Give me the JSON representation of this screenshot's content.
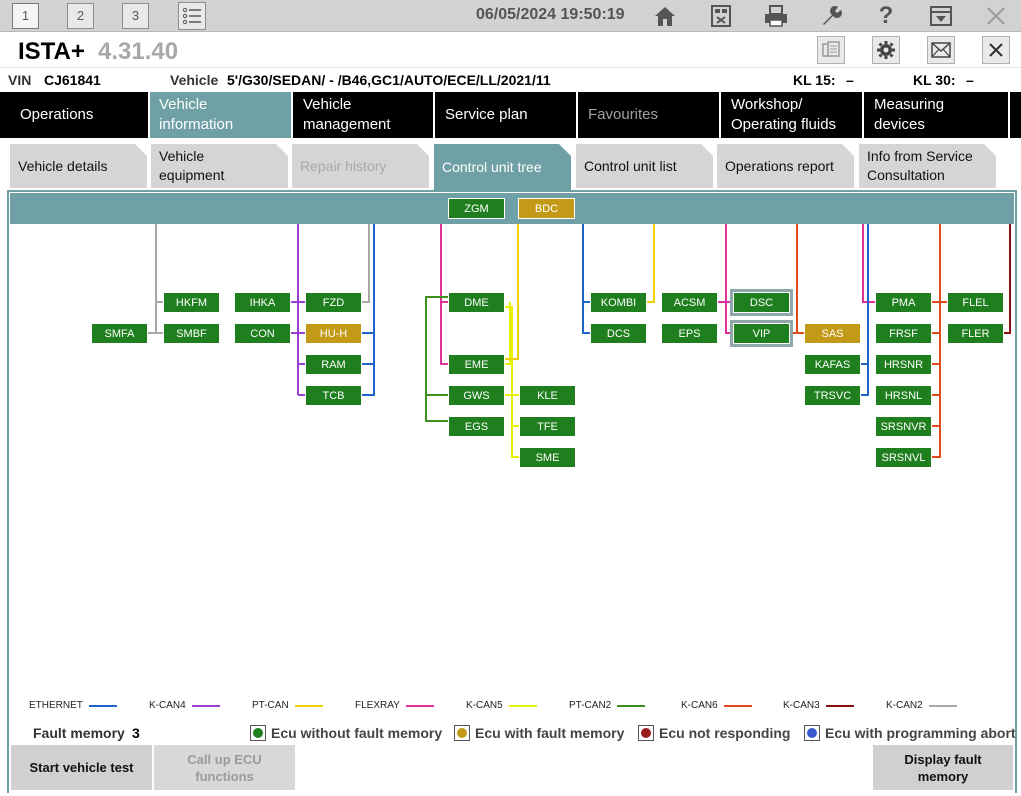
{
  "topbar": {
    "tabs": [
      "1",
      "2",
      "3"
    ],
    "datetime": "06/05/2024 19:50:19",
    "icons": [
      "list-icon",
      "home-icon",
      "connect-icon",
      "printer-icon",
      "wrench-icon",
      "help-icon",
      "menu-down-icon",
      "close-icon"
    ]
  },
  "titlebar": {
    "app": "ISTA+",
    "version": "4.31.40",
    "icons": [
      "document-icon",
      "gear-icon",
      "mail-icon",
      "close-icon"
    ]
  },
  "vin": {
    "vin_label": "VIN",
    "vin_value": "CJ61841",
    "vehicle_label": "Vehicle",
    "vehicle_value": "5'/G30/SEDAN/ - /B46,GC1/AUTO/ECE/LL/2021/11",
    "kl15_label": "KL 15:",
    "kl15_value": "–",
    "kl30_label": "KL 30:",
    "kl30_value": "–"
  },
  "mainnav": {
    "operations": "Operations",
    "vehicle_information": "Vehicle information",
    "vehicle_management_1": "Vehicle",
    "vehicle_management_2": "management",
    "service_plan": "Service plan",
    "favourites": "Favourites",
    "workshop_1": "Workshop/",
    "workshop_2": "Operating fluids",
    "measuring": "Measuring devices"
  },
  "subnav": {
    "vehicle_details": "Vehicle details",
    "vehicle_equipment_1": "Vehicle",
    "vehicle_equipment_2": "equipment",
    "repair_history": "Repair history",
    "control_unit_tree": "Control unit tree",
    "control_unit_list": "Control unit list",
    "operations_report": "Operations report",
    "info_1": "Info from Service",
    "info_2": "Consultation"
  },
  "ecus": {
    "ZGM": "ZGM",
    "BDC": "BDC",
    "HKFM": "HKFM",
    "IHKA": "IHKA",
    "FZD": "FZD",
    "SMFA": "SMFA",
    "SMBF": "SMBF",
    "CON": "CON",
    "HUH": "HU-H",
    "RAM": "RAM",
    "TCB": "TCB",
    "DME": "DME",
    "EME": "EME",
    "GWS": "GWS",
    "EGS": "EGS",
    "KLE": "KLE",
    "TFE": "TFE",
    "SME": "SME",
    "KOMBI": "KOMBI",
    "ACSM": "ACSM",
    "DSC": "DSC",
    "DCS": "DCS",
    "EPS": "EPS",
    "VIP": "VIP",
    "SAS": "SAS",
    "KAFAS": "KAFAS",
    "TRSVC": "TRSVC",
    "PMA": "PMA",
    "FLEL": "FLEL",
    "FRSF": "FRSF",
    "FLER": "FLER",
    "HRSNR": "HRSNR",
    "HRSNL": "HRSNL",
    "SRSNVR": "SRSNVR",
    "SRSNVL": "SRSNVL"
  },
  "ecu_status": {
    "ok_color": "#1f7f1f",
    "fault_color": "#c29a18",
    "fault_ecus": [
      "BDC",
      "HU-H",
      "SAS"
    ]
  },
  "legend": [
    {
      "name": "ETHERNET",
      "color": "#1f63c8"
    },
    {
      "name": "K-CAN4",
      "color": "#9b3fd0"
    },
    {
      "name": "PT-CAN",
      "color": "#f0d000"
    },
    {
      "name": "FLEXRAY",
      "color": "#e0309a"
    },
    {
      "name": "K-CAN5",
      "color": "#e6f000"
    },
    {
      "name": "PT-CAN2",
      "color": "#3c8f1e"
    },
    {
      "name": "K-CAN6",
      "color": "#e04a1a"
    },
    {
      "name": "K-CAN3",
      "color": "#8a1010"
    },
    {
      "name": "K-CAN2",
      "color": "#a8a8a8"
    }
  ],
  "fault_memory": {
    "label": "Fault memory",
    "count": "3"
  },
  "status_legend": {
    "no_fault": "Ecu without fault memory",
    "with_fault": "Ecu with fault memory",
    "not_responding": "Ecu not responding",
    "prog_abort": "Ecu with programming abort"
  },
  "buttons": {
    "start_test": "Start vehicle test",
    "call_ecu_1": "Call up ECU",
    "call_ecu_2": "functions",
    "display_fault_1": "Display fault",
    "display_fault_2": "memory"
  }
}
